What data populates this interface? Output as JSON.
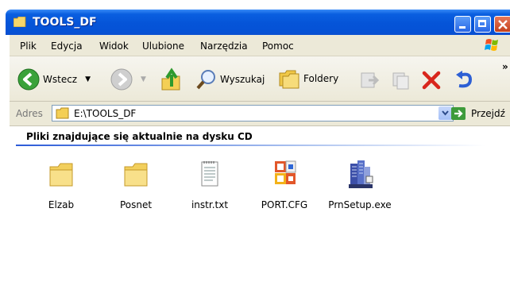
{
  "window": {
    "title": "TOOLS_DF"
  },
  "menu": [
    "Plik",
    "Edycja",
    "Widok",
    "Ulubione",
    "Narzędzia",
    "Pomoc"
  ],
  "toolbar": {
    "back_label": "Wstecz",
    "search_label": "Wyszukaj",
    "folders_label": "Foldery"
  },
  "address": {
    "label": "Adres",
    "value": "E:\\TOOLS_DF",
    "go_label": "Przejdź"
  },
  "content": {
    "heading": "Pliki znajdujące się aktualnie na dysku CD",
    "files": [
      {
        "name": "Elzab",
        "icon": "folder-icon"
      },
      {
        "name": "Posnet",
        "icon": "folder-icon"
      },
      {
        "name": "instr.txt",
        "icon": "text-file-icon"
      },
      {
        "name": "PORT.CFG",
        "icon": "config-file-icon"
      },
      {
        "name": "PrnSetup.exe",
        "icon": "setup-exe-icon"
      }
    ]
  },
  "colors": {
    "titlebar": "#0554d8",
    "chrome": "#ece9d8",
    "heading_rule": "#2c5bd8"
  }
}
